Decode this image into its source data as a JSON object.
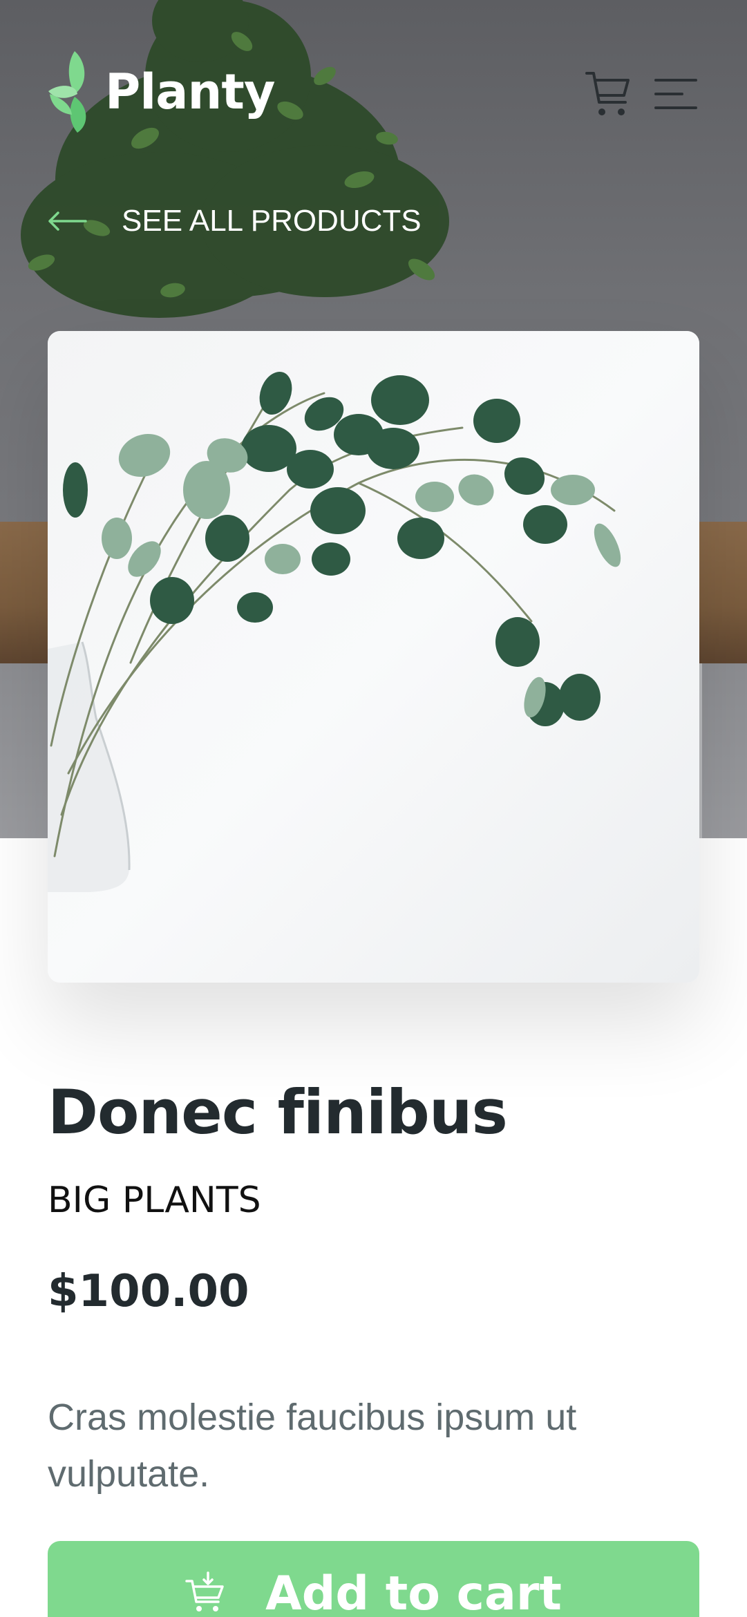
{
  "header": {
    "brand": "Planty",
    "logo_icon": "leaf-logo-icon",
    "cart_icon": "cart-icon",
    "menu_icon": "hamburger-menu-icon"
  },
  "navigation": {
    "back_label": "SEE ALL PRODUCTS",
    "back_icon": "arrow-left-icon"
  },
  "product": {
    "name": "Donec finibus",
    "category": "BIG PLANTS",
    "price": "$100.00",
    "description": "Cras molestie faucibus ipsum ut vulputate.",
    "image": "eucalyptus-branches-in-glass-vase"
  },
  "actions": {
    "add_to_cart_label": "Add to cart",
    "add_to_cart_icon": "add-to-cart-icon"
  },
  "colors": {
    "accent": "#7fd98e",
    "title": "#232b2f",
    "body_text": "#5f6b6f",
    "hero_bg": "#6f7074"
  }
}
